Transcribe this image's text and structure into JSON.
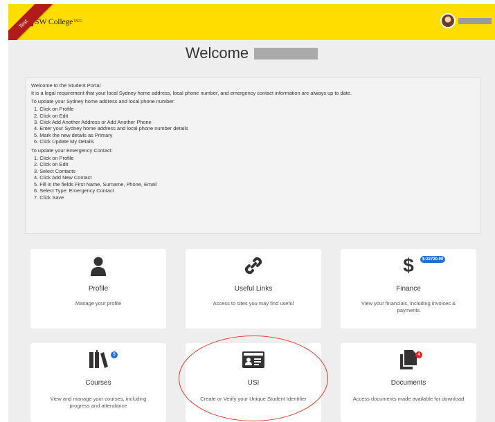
{
  "header": {
    "logo_text": "SW College",
    "logo_sup": "TAFE",
    "ribbon_label": "Test"
  },
  "welcome": {
    "title": "Welcome"
  },
  "notice": {
    "intro": "Welcome to the Student Portal",
    "requirement": "It is a legal requirement that your local Sydney home address, local phone number, and emergency contact information are always up to date.",
    "address_heading": "To update your Sydney home address and local phone number:",
    "address_steps": [
      "1. Click on Profile",
      "2. Click on Edit",
      "3. Click Add Another Address or Add Another Phone",
      "4. Enter your Sydney home address and local phone number details",
      "5. Mark the new details as Primary",
      "6. Click Update My Details"
    ],
    "contact_heading": "To update your Emergency Contact:",
    "contact_steps": [
      "1. Click on Profile",
      "2. Click on Edit",
      "3. Select Contacts",
      "4. Click Add New Contact",
      "5. Fill in the fields First Name, Surname, Phone, Email",
      "6. Select Type: Emergency Contact",
      "7. Click Save"
    ]
  },
  "tiles": [
    {
      "title": "Profile",
      "desc": "Manage your profile",
      "icon": "person-icon"
    },
    {
      "title": "Useful Links",
      "desc": "Access to sites you may find useful",
      "icon": "link-icon"
    },
    {
      "title": "Finance",
      "desc": "View your financials, including invoices & payments",
      "icon": "dollar-icon",
      "badge": "$-22720.00"
    },
    {
      "title": "Courses",
      "desc": "View and manage your courses, including progress and attendance",
      "icon": "books-icon",
      "badge": "5"
    },
    {
      "title": "USI",
      "desc": "Create or Verify your Unique Student Identifier",
      "icon": "id-card-icon"
    },
    {
      "title": "Documents",
      "desc": "Access documents made available for download",
      "icon": "documents-icon",
      "badge": "4"
    }
  ],
  "colors": {
    "header": "#ffdd00",
    "ribbon": "#b11b1b",
    "badge_blue": "#1f6fd6",
    "badge_red": "#e02020",
    "annotation": "#e03a2a"
  }
}
